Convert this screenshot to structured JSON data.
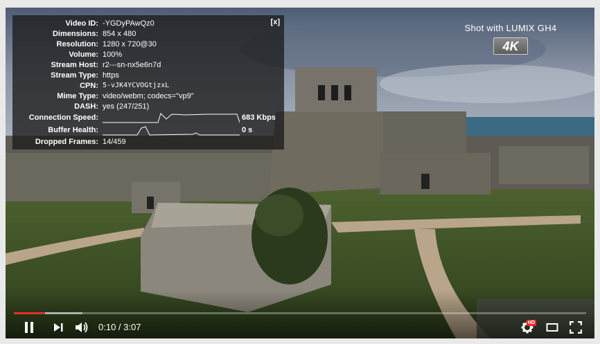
{
  "watermark": {
    "text": "Shot with LUMIX GH4",
    "badge": "4K"
  },
  "stats": {
    "close_label": "[x]",
    "rows": [
      {
        "label": "Video ID:",
        "value": "-YGDyPAwQz0"
      },
      {
        "label": "Dimensions:",
        "value": "854 x 480"
      },
      {
        "label": "Resolution:",
        "value": "1280 x 720@30"
      },
      {
        "label": "Volume:",
        "value": "100%"
      },
      {
        "label": "Stream Host:",
        "value": "r2---sn-nx5e6n7d"
      },
      {
        "label": "Stream Type:",
        "value": "https"
      },
      {
        "label": "CPN:",
        "value": "5-vJK4YCVOGtjzxL"
      },
      {
        "label": "Mime Type:",
        "value": "video/webm; codecs=\"vp9\""
      },
      {
        "label": "DASH:",
        "value": "yes (247/251)"
      }
    ],
    "connection_speed": {
      "label": "Connection Speed:",
      "value": "683 Kbps"
    },
    "buffer_health": {
      "label": "Buffer Health:",
      "value": "0 s"
    },
    "dropped_frames": {
      "label": "Dropped Frames:",
      "value": "14/459"
    }
  },
  "controls": {
    "time_display": "0:10 / 3:07",
    "progress_played": 0.055,
    "hd_badge": "HD",
    "accent_color": "#e52d27"
  }
}
